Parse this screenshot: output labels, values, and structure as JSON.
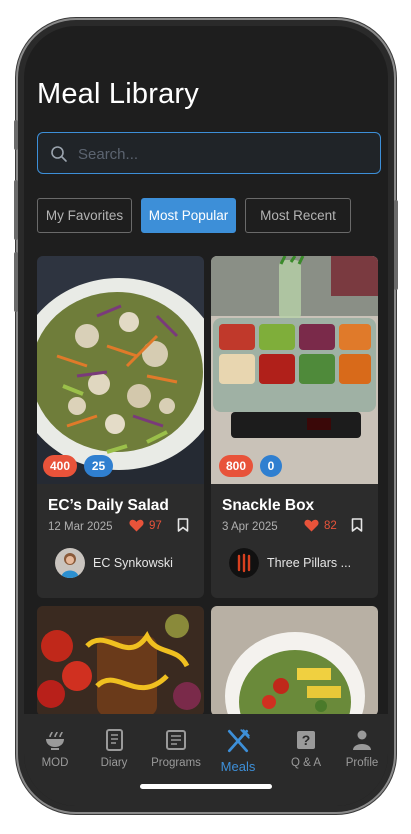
{
  "header": {
    "title": "Meal Library"
  },
  "search": {
    "placeholder": "Search..."
  },
  "filters": [
    {
      "label": "My Favorites",
      "active": false
    },
    {
      "label": "Most Popular",
      "active": true
    },
    {
      "label": "Most Recent",
      "active": false
    }
  ],
  "cards": [
    {
      "title": "EC’s Daily Salad",
      "date": "12 Mar 2025",
      "likes": "97",
      "calories": "400",
      "protein": "25",
      "author": "EC Synkowski"
    },
    {
      "title": "Snackle Box",
      "date": "3 Apr 2025",
      "likes": "82",
      "calories": "800",
      "protein": "0",
      "author": "Three Pillars ..."
    }
  ],
  "tabs": [
    {
      "label": "MOD",
      "icon": "bowl-icon"
    },
    {
      "label": "Diary",
      "icon": "diary-icon"
    },
    {
      "label": "Programs",
      "icon": "programs-icon"
    },
    {
      "label": "Meals",
      "icon": "fork-knife-icon",
      "active": true
    },
    {
      "label": "Q & A",
      "icon": "question-icon"
    },
    {
      "label": "Profile",
      "icon": "person-icon"
    }
  ],
  "colors": {
    "accent": "#3d8fd8",
    "calorie_badge": "#e8533a",
    "protein_badge": "#2f7fd0",
    "background": "#1e1e1e"
  }
}
